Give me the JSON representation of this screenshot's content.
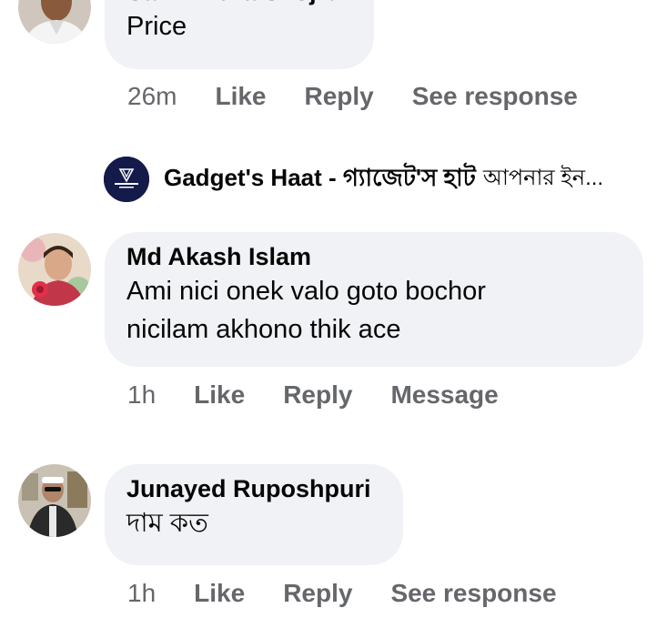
{
  "comments": [
    {
      "author": "Salim Reza Shojib",
      "text_lines": [
        "Price"
      ],
      "time": "26m",
      "actions": [
        "Like",
        "Reply",
        "See response"
      ]
    },
    {
      "author": "Md Akash Islam",
      "text_lines": [
        "Ami nici onek valo goto bochor",
        "nicilam akhono thik ace"
      ],
      "time": "1h",
      "actions": [
        "Like",
        "Reply",
        "Message"
      ]
    },
    {
      "author": "Junayed Ruposhpuri",
      "text_lines": [
        "দাম কত"
      ],
      "time": "1h",
      "actions": [
        "Like",
        "Reply",
        "See response"
      ]
    }
  ],
  "reply_preview": {
    "author": "Gadget's Haat - গ্যাজেট'স হাট",
    "snippet": "আপনার ইন..."
  },
  "colors": {
    "bubble_bg": "#f0f2f5",
    "action_text": "#65676b",
    "page_avatar_bg": "#141a4a"
  }
}
